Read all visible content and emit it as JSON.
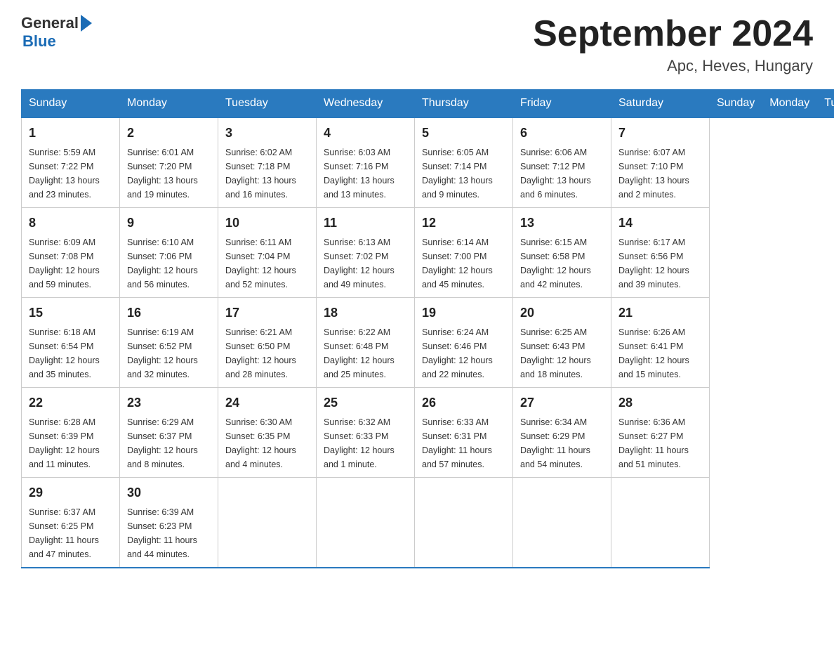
{
  "header": {
    "title": "September 2024",
    "location": "Apc, Heves, Hungary",
    "logo_general": "General",
    "logo_blue": "Blue"
  },
  "days_of_week": [
    "Sunday",
    "Monday",
    "Tuesday",
    "Wednesday",
    "Thursday",
    "Friday",
    "Saturday"
  ],
  "weeks": [
    [
      {
        "day": "1",
        "sunrise": "Sunrise: 5:59 AM",
        "sunset": "Sunset: 7:22 PM",
        "daylight": "Daylight: 13 hours and 23 minutes."
      },
      {
        "day": "2",
        "sunrise": "Sunrise: 6:01 AM",
        "sunset": "Sunset: 7:20 PM",
        "daylight": "Daylight: 13 hours and 19 minutes."
      },
      {
        "day": "3",
        "sunrise": "Sunrise: 6:02 AM",
        "sunset": "Sunset: 7:18 PM",
        "daylight": "Daylight: 13 hours and 16 minutes."
      },
      {
        "day": "4",
        "sunrise": "Sunrise: 6:03 AM",
        "sunset": "Sunset: 7:16 PM",
        "daylight": "Daylight: 13 hours and 13 minutes."
      },
      {
        "day": "5",
        "sunrise": "Sunrise: 6:05 AM",
        "sunset": "Sunset: 7:14 PM",
        "daylight": "Daylight: 13 hours and 9 minutes."
      },
      {
        "day": "6",
        "sunrise": "Sunrise: 6:06 AM",
        "sunset": "Sunset: 7:12 PM",
        "daylight": "Daylight: 13 hours and 6 minutes."
      },
      {
        "day": "7",
        "sunrise": "Sunrise: 6:07 AM",
        "sunset": "Sunset: 7:10 PM",
        "daylight": "Daylight: 13 hours and 2 minutes."
      }
    ],
    [
      {
        "day": "8",
        "sunrise": "Sunrise: 6:09 AM",
        "sunset": "Sunset: 7:08 PM",
        "daylight": "Daylight: 12 hours and 59 minutes."
      },
      {
        "day": "9",
        "sunrise": "Sunrise: 6:10 AM",
        "sunset": "Sunset: 7:06 PM",
        "daylight": "Daylight: 12 hours and 56 minutes."
      },
      {
        "day": "10",
        "sunrise": "Sunrise: 6:11 AM",
        "sunset": "Sunset: 7:04 PM",
        "daylight": "Daylight: 12 hours and 52 minutes."
      },
      {
        "day": "11",
        "sunrise": "Sunrise: 6:13 AM",
        "sunset": "Sunset: 7:02 PM",
        "daylight": "Daylight: 12 hours and 49 minutes."
      },
      {
        "day": "12",
        "sunrise": "Sunrise: 6:14 AM",
        "sunset": "Sunset: 7:00 PM",
        "daylight": "Daylight: 12 hours and 45 minutes."
      },
      {
        "day": "13",
        "sunrise": "Sunrise: 6:15 AM",
        "sunset": "Sunset: 6:58 PM",
        "daylight": "Daylight: 12 hours and 42 minutes."
      },
      {
        "day": "14",
        "sunrise": "Sunrise: 6:17 AM",
        "sunset": "Sunset: 6:56 PM",
        "daylight": "Daylight: 12 hours and 39 minutes."
      }
    ],
    [
      {
        "day": "15",
        "sunrise": "Sunrise: 6:18 AM",
        "sunset": "Sunset: 6:54 PM",
        "daylight": "Daylight: 12 hours and 35 minutes."
      },
      {
        "day": "16",
        "sunrise": "Sunrise: 6:19 AM",
        "sunset": "Sunset: 6:52 PM",
        "daylight": "Daylight: 12 hours and 32 minutes."
      },
      {
        "day": "17",
        "sunrise": "Sunrise: 6:21 AM",
        "sunset": "Sunset: 6:50 PM",
        "daylight": "Daylight: 12 hours and 28 minutes."
      },
      {
        "day": "18",
        "sunrise": "Sunrise: 6:22 AM",
        "sunset": "Sunset: 6:48 PM",
        "daylight": "Daylight: 12 hours and 25 minutes."
      },
      {
        "day": "19",
        "sunrise": "Sunrise: 6:24 AM",
        "sunset": "Sunset: 6:46 PM",
        "daylight": "Daylight: 12 hours and 22 minutes."
      },
      {
        "day": "20",
        "sunrise": "Sunrise: 6:25 AM",
        "sunset": "Sunset: 6:43 PM",
        "daylight": "Daylight: 12 hours and 18 minutes."
      },
      {
        "day": "21",
        "sunrise": "Sunrise: 6:26 AM",
        "sunset": "Sunset: 6:41 PM",
        "daylight": "Daylight: 12 hours and 15 minutes."
      }
    ],
    [
      {
        "day": "22",
        "sunrise": "Sunrise: 6:28 AM",
        "sunset": "Sunset: 6:39 PM",
        "daylight": "Daylight: 12 hours and 11 minutes."
      },
      {
        "day": "23",
        "sunrise": "Sunrise: 6:29 AM",
        "sunset": "Sunset: 6:37 PM",
        "daylight": "Daylight: 12 hours and 8 minutes."
      },
      {
        "day": "24",
        "sunrise": "Sunrise: 6:30 AM",
        "sunset": "Sunset: 6:35 PM",
        "daylight": "Daylight: 12 hours and 4 minutes."
      },
      {
        "day": "25",
        "sunrise": "Sunrise: 6:32 AM",
        "sunset": "Sunset: 6:33 PM",
        "daylight": "Daylight: 12 hours and 1 minute."
      },
      {
        "day": "26",
        "sunrise": "Sunrise: 6:33 AM",
        "sunset": "Sunset: 6:31 PM",
        "daylight": "Daylight: 11 hours and 57 minutes."
      },
      {
        "day": "27",
        "sunrise": "Sunrise: 6:34 AM",
        "sunset": "Sunset: 6:29 PM",
        "daylight": "Daylight: 11 hours and 54 minutes."
      },
      {
        "day": "28",
        "sunrise": "Sunrise: 6:36 AM",
        "sunset": "Sunset: 6:27 PM",
        "daylight": "Daylight: 11 hours and 51 minutes."
      }
    ],
    [
      {
        "day": "29",
        "sunrise": "Sunrise: 6:37 AM",
        "sunset": "Sunset: 6:25 PM",
        "daylight": "Daylight: 11 hours and 47 minutes."
      },
      {
        "day": "30",
        "sunrise": "Sunrise: 6:39 AM",
        "sunset": "Sunset: 6:23 PM",
        "daylight": "Daylight: 11 hours and 44 minutes."
      },
      {
        "day": "",
        "sunrise": "",
        "sunset": "",
        "daylight": ""
      },
      {
        "day": "",
        "sunrise": "",
        "sunset": "",
        "daylight": ""
      },
      {
        "day": "",
        "sunrise": "",
        "sunset": "",
        "daylight": ""
      },
      {
        "day": "",
        "sunrise": "",
        "sunset": "",
        "daylight": ""
      },
      {
        "day": "",
        "sunrise": "",
        "sunset": "",
        "daylight": ""
      }
    ]
  ]
}
